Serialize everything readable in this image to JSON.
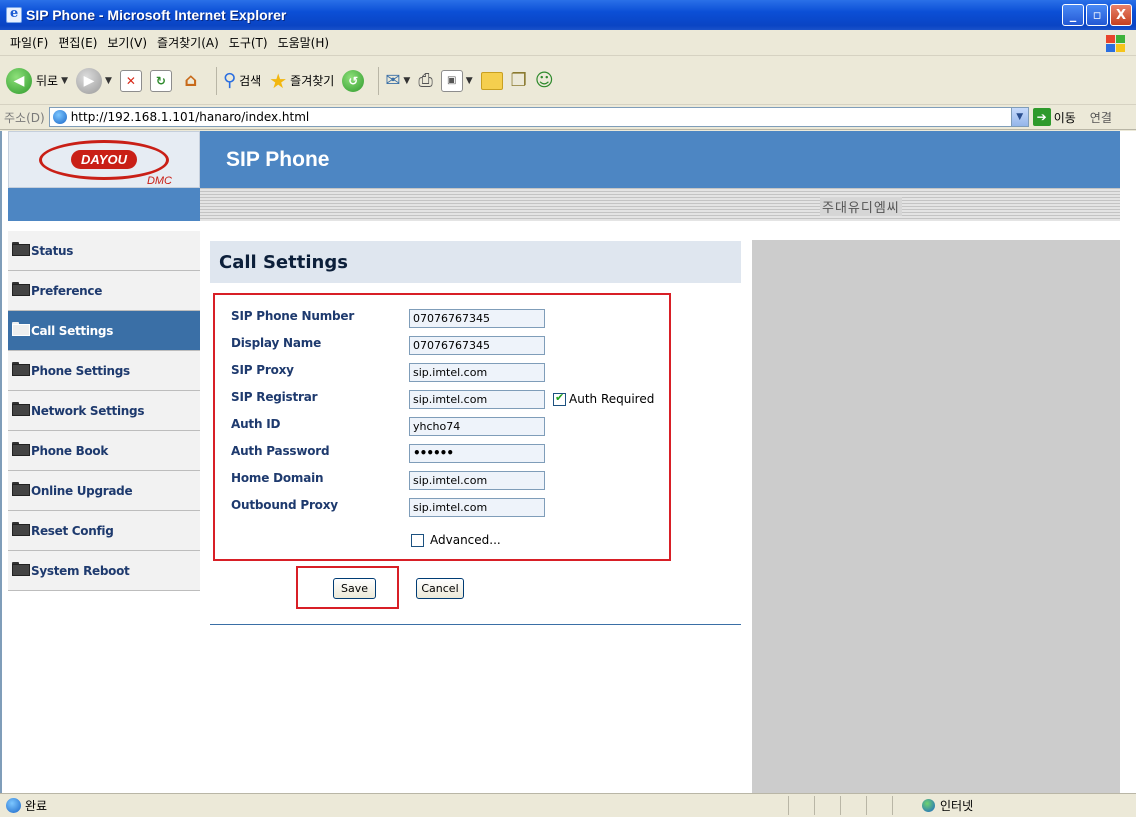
{
  "window": {
    "title": "SIP Phone - Microsoft Internet Explorer",
    "buttons": {
      "minimize": "_",
      "maximize": "▫",
      "close": "X"
    }
  },
  "menu": [
    "파일(F)",
    "편집(E)",
    "보기(V)",
    "즐겨찾기(A)",
    "도구(T)",
    "도움말(H)"
  ],
  "toolbar": {
    "back_label": "뒤로",
    "search_label": "검색",
    "favorites_label": "즐겨찾기"
  },
  "address": {
    "label": "주소(D)",
    "url": "http://192.168.1.101/hanaro/index.html",
    "go_label": "이동",
    "links_label": "연결"
  },
  "page": {
    "logo": {
      "brand": "DAYOU",
      "sub": "DMC"
    },
    "header_title": "SIP Phone",
    "company": "주대유디엠씨",
    "nav": [
      {
        "label": "Status",
        "active": false
      },
      {
        "label": "Preference",
        "active": false
      },
      {
        "label": "Call Settings",
        "active": true
      },
      {
        "label": "Phone Settings",
        "active": false
      },
      {
        "label": "Network Settings",
        "active": false
      },
      {
        "label": "Phone Book",
        "active": false
      },
      {
        "label": "Online Upgrade",
        "active": false
      },
      {
        "label": "Reset Config",
        "active": false
      },
      {
        "label": "System Reboot",
        "active": false
      }
    ],
    "section_title": "Call Settings",
    "fields": [
      {
        "label": "SIP Phone Number",
        "value": "07076767345"
      },
      {
        "label": "Display Name",
        "value": "07076767345"
      },
      {
        "label": "SIP Proxy",
        "value": "sip.imtel.com"
      },
      {
        "label": "SIP Registrar",
        "value": "sip.imtel.com"
      },
      {
        "label": "Auth ID",
        "value": "yhcho74"
      },
      {
        "label": "Auth Password",
        "value": "••••••"
      },
      {
        "label": "Home Domain",
        "value": "sip.imtel.com"
      },
      {
        "label": "Outbound Proxy",
        "value": "sip.imtel.com"
      }
    ],
    "auth_required": {
      "label": "Auth Required",
      "checked": true
    },
    "advanced": {
      "label": "Advanced...",
      "checked": false
    },
    "save_label": "Save",
    "cancel_label": "Cancel"
  },
  "status": {
    "text": "완료",
    "zone": "인터넷"
  }
}
